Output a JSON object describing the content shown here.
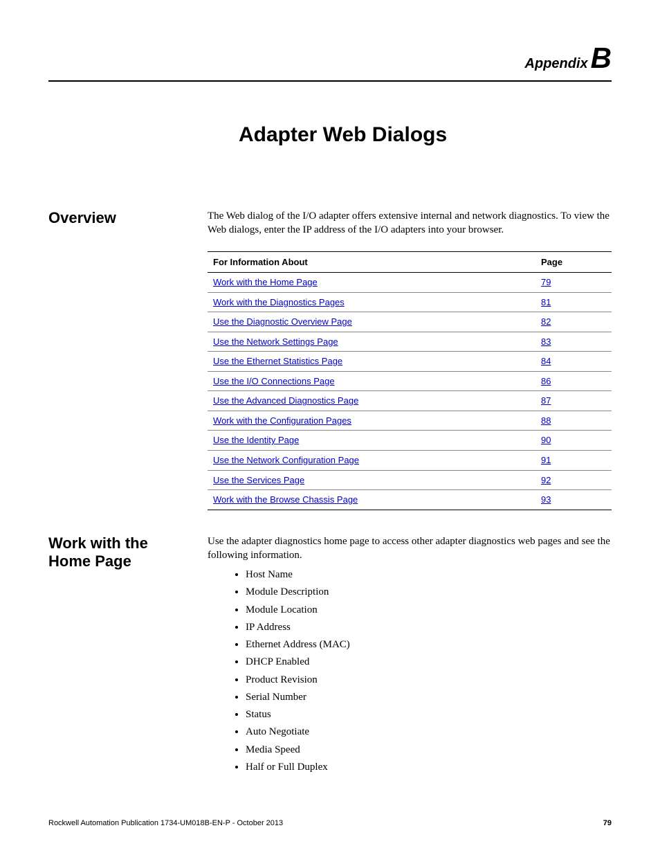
{
  "header": {
    "appendix_word": "Appendix",
    "appendix_letter": "B"
  },
  "chapter_title": "Adapter Web Dialogs",
  "overview": {
    "heading": "Overview",
    "paragraph": "The Web dialog of the I/O adapter offers extensive internal and network diagnostics. To view the Web dialogs, enter the IP address of the I/O adapters into your browser.",
    "table": {
      "col1_header": "For Information About",
      "col2_header": "Page",
      "rows": [
        {
          "label": "Work with the Home Page",
          "page": "79"
        },
        {
          "label": "Work with the Diagnostics Pages",
          "page": "81"
        },
        {
          "label": "Use the Diagnostic Overview Page",
          "page": "82"
        },
        {
          "label": "Use the Network Settings Page",
          "page": "83"
        },
        {
          "label": "Use the Ethernet Statistics Page",
          "page": "84"
        },
        {
          "label": "Use the I/O Connections Page",
          "page": "86"
        },
        {
          "label": "Use the Advanced Diagnostics Page",
          "page": "87"
        },
        {
          "label": "Work with the Configuration Pages",
          "page": "88"
        },
        {
          "label": "Use the Identity Page",
          "page": "90"
        },
        {
          "label": "Use the Network Configuration Page",
          "page": "91"
        },
        {
          "label": "Use the Services Page",
          "page": "92"
        },
        {
          "label": "Work with the Browse Chassis Page",
          "page": "93"
        }
      ]
    }
  },
  "homepage": {
    "heading": "Work with the Home Page",
    "intro": "Use the adapter diagnostics home page to access other adapter diagnostics web pages and see the following information.",
    "items": [
      "Host Name",
      "Module Description",
      "Module Location",
      "IP Address",
      "Ethernet Address (MAC)",
      "DHCP Enabled",
      "Product Revision",
      "Serial Number",
      "Status",
      "Auto Negotiate",
      "Media Speed",
      "Half or Full Duplex"
    ]
  },
  "footer": {
    "publication": "Rockwell Automation Publication 1734-UM018B-EN-P - October 2013",
    "page_number": "79"
  }
}
